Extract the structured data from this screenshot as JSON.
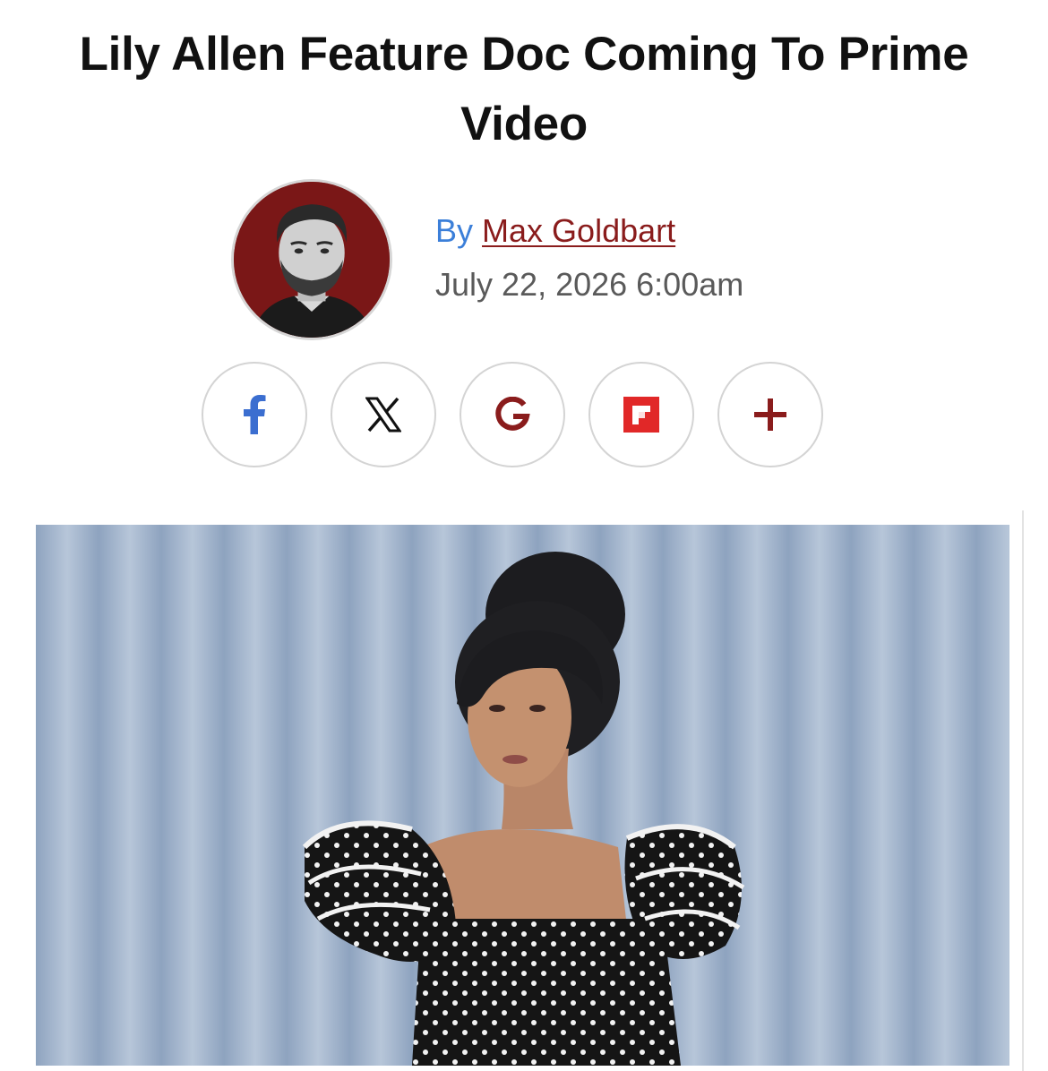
{
  "article": {
    "headline": "Lily Allen Feature Doc Coming To Prime Video",
    "byline": {
      "prefix": "By",
      "author": "Max Goldbart"
    },
    "date": "July 22, 2026 6:00am"
  },
  "share": [
    {
      "name": "facebook-icon",
      "glyph": "f",
      "color": "#3b6ed0"
    },
    {
      "name": "x-icon",
      "glyph": "X",
      "color": "#111111"
    },
    {
      "name": "google-icon",
      "glyph": "G",
      "color": "#8a1c1c"
    },
    {
      "name": "flipboard-icon",
      "glyph": "flipboard",
      "color": "#e12828"
    },
    {
      "name": "plus-icon",
      "glyph": "+",
      "color": "#8a1c1c"
    }
  ],
  "colors": {
    "accent": "#8a1c1c",
    "byline_prefix": "#3b7fd9",
    "date": "#5a5a5a"
  }
}
